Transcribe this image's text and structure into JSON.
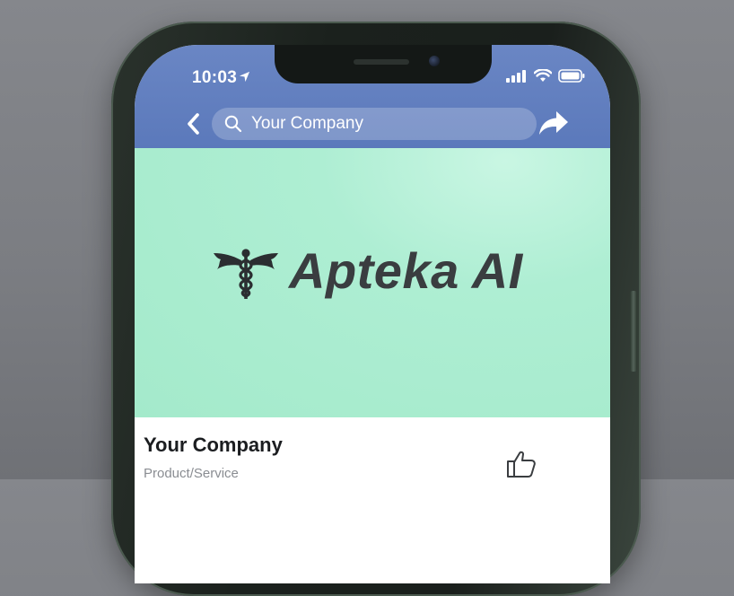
{
  "status_bar": {
    "time": "10:03",
    "icons": [
      "location-arrow-icon",
      "signal-bars-icon",
      "wifi-icon",
      "battery-icon"
    ]
  },
  "nav_bar": {
    "search_value": "Your Company",
    "icons": [
      "back-chevron-icon",
      "search-icon",
      "share-arrow-icon"
    ]
  },
  "cover": {
    "brand_name": "Apteka AI",
    "logo_icon": "caduceus-icon"
  },
  "page_info": {
    "name": "Your Company",
    "category": "Product/Service",
    "like_icon": "thumbs-up-icon"
  },
  "colors": {
    "nav_blue": "#5b79bb",
    "cover_mint": "#a4eacb",
    "brand_text": "#3a3d40",
    "background_gray": "#7b7d82"
  }
}
